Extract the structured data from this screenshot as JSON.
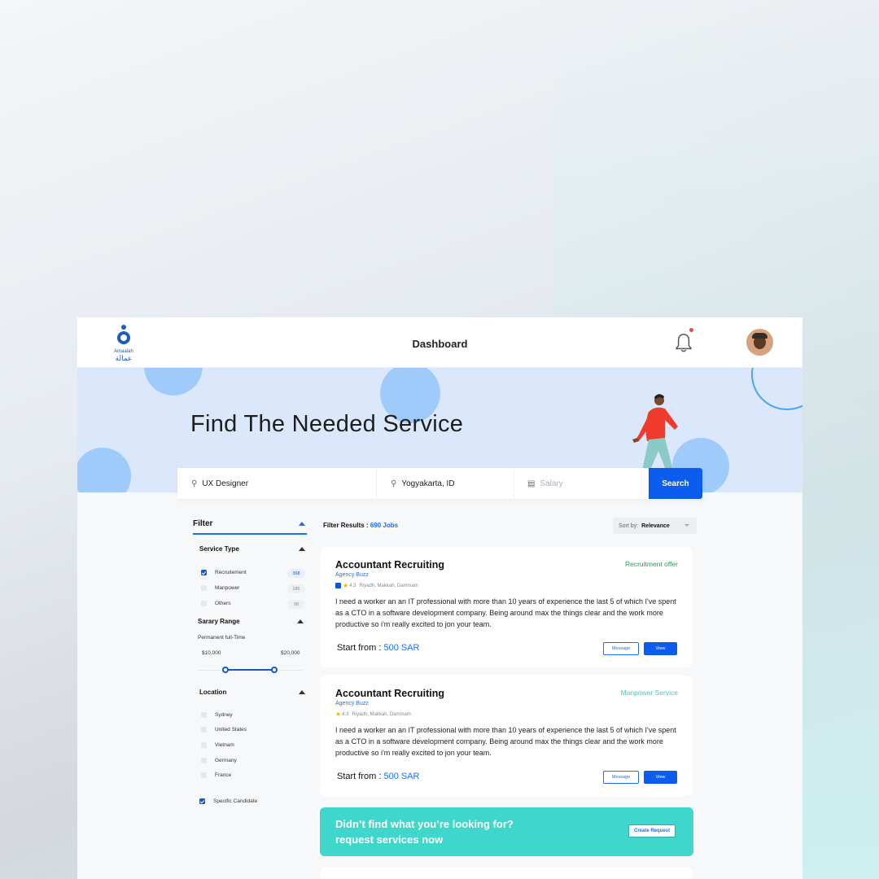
{
  "header": {
    "title": "Dashboard",
    "logo_text": "Amaalah",
    "logo_arabic": "عمالة"
  },
  "hero": {
    "title": "Find The Needed Service"
  },
  "search": {
    "keyword_value": "UX Designer",
    "location_value": "Yogyakarta, ID",
    "salary_placeholder": "Salary",
    "button_label": "Search"
  },
  "filter": {
    "title": "Filter",
    "service_type": {
      "title": "Service Type",
      "options": [
        {
          "label": "Recruitement",
          "count": "368",
          "checked": true
        },
        {
          "label": "Manpower",
          "count": "185",
          "checked": false
        },
        {
          "label": "Others",
          "count": "98",
          "checked": false
        }
      ]
    },
    "salary_range": {
      "title": "Sarary Range",
      "subtitle": "Permanent full-Time",
      "min": "$10,000",
      "max": "$20,000"
    },
    "location": {
      "title": "Location",
      "options": [
        "Sydney",
        "United States",
        "Vietnam",
        "Germany",
        "France"
      ]
    },
    "specific_candidate": "Specific Candidate"
  },
  "results": {
    "label": "Filter Results :",
    "count_text": "690 Jobs",
    "sort_label": "Sort by:",
    "sort_value": "Relevance"
  },
  "cards": [
    {
      "title": "Accountant Recruiting",
      "agency": "Agency Buzz",
      "rating": "4.3",
      "locations": "Riyadh, Makkah, Dammam",
      "tag": "Recruitment offer",
      "tag_color": "#2a9d5c",
      "description": "I need a worker an an IT professional with more than 10 years of experience the last 5 of which I've spent as a CTO in a software development company. Being around max the things clear and the work more productive so i'm really excited to jon your team.",
      "price_label": "Start from :",
      "price_value": "500 SAR",
      "message_label": "Message",
      "view_label": "View"
    },
    {
      "title": "Accountant Recruiting",
      "agency": "Agency Buzz",
      "rating": "4.3",
      "locations": "Riyadh, Makkah, Dammam",
      "tag": "Manpower Service",
      "tag_color": "#3fc9c0",
      "description": "I need a worker an an IT professional with more than 10 years of experience the last 5 of which I've spent as a CTO in a software development company. Being around max the things clear and the work more productive so i'm really excited to jon your team.",
      "price_label": "Start from :",
      "price_value": "500 SAR",
      "message_label": "Message",
      "view_label": "View"
    }
  ],
  "cta": {
    "line1": "Didn’t find what you’re looking for?",
    "line2": "request services now",
    "button_label": "Create Request"
  },
  "colors": {
    "primary": "#0d5cf0",
    "cta": "#3fd6cc",
    "hero_bg": "#dbe8fb"
  }
}
